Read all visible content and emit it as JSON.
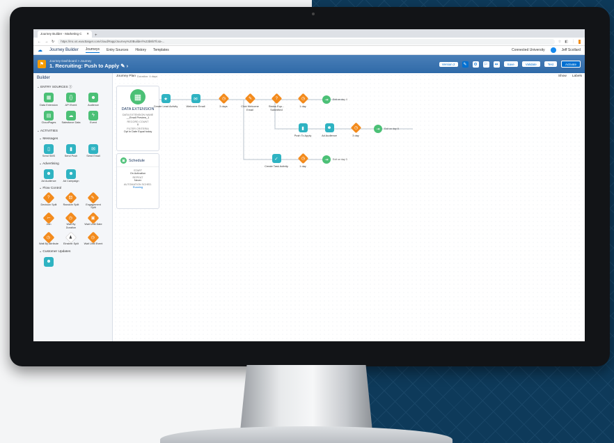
{
  "browser": {
    "tab_title": "Journey Builder - Marketing C",
    "url": "https://mc.s4.exacttarget.com/cloud/#app/Journey%20Builder/%23b9b7fc4a-..."
  },
  "app_nav": {
    "app_name": "Journey Builder",
    "tabs": [
      "Journeys",
      "Entry Sources",
      "History",
      "Templates"
    ],
    "org": "Connected University",
    "user": "Jeff Scollard"
  },
  "header": {
    "breadcrumb": "Journey Dashboard > Journey",
    "title": "1. Recruiting: Push to Apply",
    "version": "Version 2",
    "buttons": {
      "save": "Save",
      "validate": "Validate",
      "test": "Test",
      "activate": "Activate"
    }
  },
  "sidebar": {
    "title": "Builder",
    "entry_sources_label": "ENTRY SOURCES",
    "entry_sources": [
      {
        "label": "Data Extension",
        "icon": "table-icon",
        "color": "green"
      },
      {
        "label": "API Event",
        "icon": "code-icon",
        "color": "green"
      },
      {
        "label": "Audience",
        "icon": "people-icon",
        "color": "green"
      },
      {
        "label": "CloudPages",
        "icon": "page-icon",
        "color": "green"
      },
      {
        "label": "Salesforce Data",
        "icon": "cloud-icon",
        "color": "green"
      },
      {
        "label": "Event",
        "icon": "lightning-icon",
        "color": "green"
      }
    ],
    "activities_label": "ACTIVITIES",
    "messages_label": "Messages",
    "messages": [
      {
        "label": "Send SMS",
        "icon": "sms-icon",
        "color": "teal"
      },
      {
        "label": "Send Push",
        "icon": "push-icon",
        "color": "teal"
      },
      {
        "label": "Send Email",
        "icon": "email-icon",
        "color": "teal"
      }
    ],
    "advertising_label": "Advertising",
    "advertising": [
      {
        "label": "Ad Audience",
        "icon": "ad-audience-icon",
        "color": "teal"
      },
      {
        "label": "Ad Campaign",
        "icon": "ad-campaign-icon",
        "color": "teal"
      }
    ],
    "flow_control_label": "Flow Control",
    "flow_control": [
      {
        "label": "Decision Split",
        "icon": "question-icon"
      },
      {
        "label": "Random Split",
        "icon": "random-icon"
      },
      {
        "label": "Engagement Split",
        "icon": "engagement-icon"
      },
      {
        "label": "Join",
        "icon": "join-icon"
      },
      {
        "label": "Wait By Duration",
        "icon": "clock-icon"
      },
      {
        "label": "Wait Until Date",
        "icon": "calendar-icon"
      },
      {
        "label": "Wait By Attribute",
        "icon": "attribute-icon"
      },
      {
        "label": "Einstein Split",
        "icon": "einstein-icon"
      },
      {
        "label": "Wait Until Event",
        "icon": "event-icon"
      }
    ],
    "customer_updates_label": "Customer Updates"
  },
  "canvas": {
    "plan_label": "Journey Plan",
    "duration": "Duration: 4 days",
    "show_label": "Show",
    "labels_label": "Labels",
    "entry": {
      "title": "DATA EXTENSION",
      "k1": "DATA EXTENSION NAME",
      "v1": "__Email Preview_1",
      "k2": "RECORD COUNT",
      "v2": "0",
      "k3": "FILTER CRITERIA",
      "v3": "Opt In Date Equal today"
    },
    "schedule": {
      "title": "Schedule",
      "k1": "START",
      "v1": "On Activation",
      "k2": "REPEAT",
      "v2": "Never",
      "k3": "AUTOMATION SCHED.",
      "v3": "Running"
    },
    "nodes": {
      "create_lead": "Create Lead Activity",
      "welcome_email": "Welcome Email",
      "wait_3days": "3 days",
      "click_welcome": "Click Welcome Email",
      "status_submitted": "Status Equ... Submitted",
      "wait_1day_a": "1 day",
      "exit_a": "Exit on day 4",
      "push_apply": "Push To Apply",
      "ad_audience": "Ad Audience",
      "wait_3day_b": "3 day",
      "exit_b": "Exit on day 8",
      "create_task": "Create Task Activity",
      "wait_1day_c": "1 day",
      "exit_c": "Exit on day 3"
    }
  }
}
